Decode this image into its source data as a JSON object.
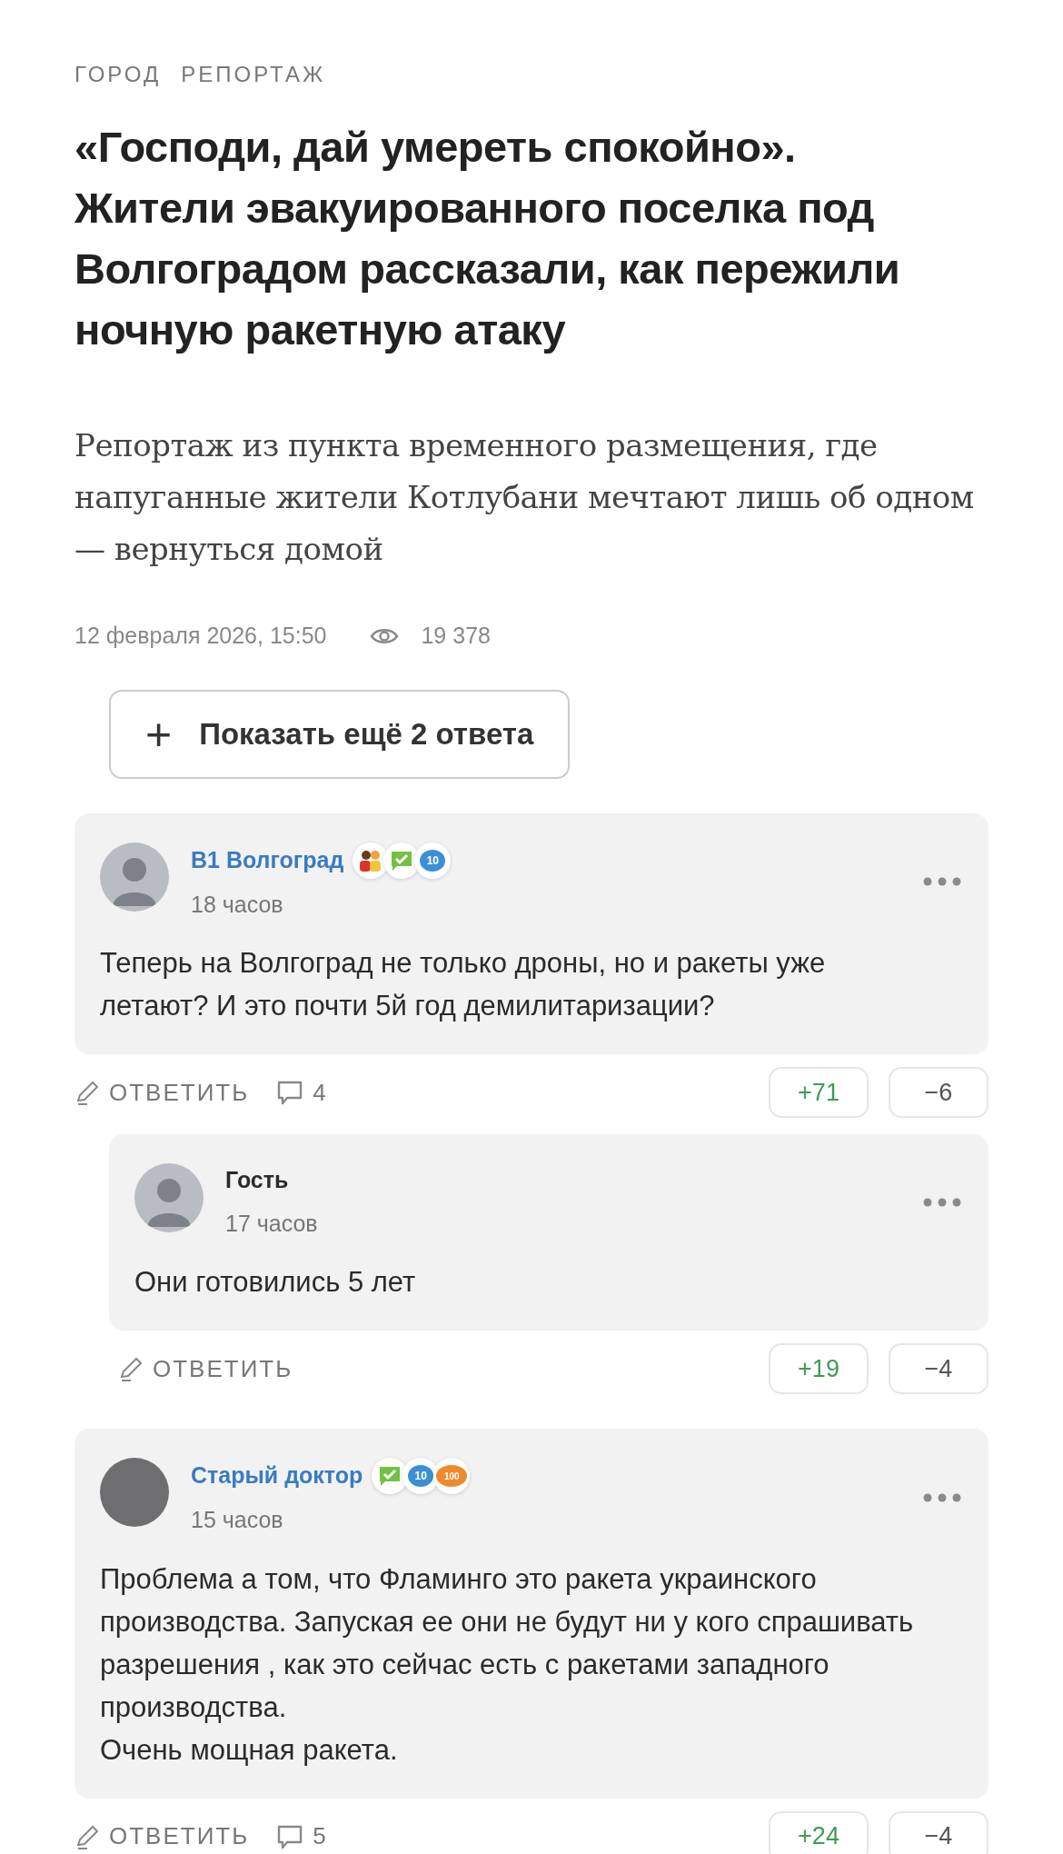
{
  "rubrics": [
    "ГОРОД",
    "РЕПОРТАЖ"
  ],
  "title": "«Господи, дай умереть спокойно». Жители эвакуированного поселка под Волгоградом рассказали, как пережили ночную ракетную атаку",
  "lead": "Репортаж из пункта временного размещения, где напуганные жители Котлубани мечтают лишь об одном — вернуться домой",
  "meta": {
    "date": "12 февраля 2026, 15:50",
    "views": "19 378"
  },
  "show_more": {
    "icon": "+",
    "label": "Показать ещё 2 ответа"
  },
  "comments": [
    {
      "author": "В1 Волгоград",
      "registered": true,
      "avatar": {
        "kind": "silhouette"
      },
      "badges": [
        {
          "kind": "people"
        },
        {
          "kind": "check"
        },
        {
          "kind": "bubble",
          "color": "#3c8fd6",
          "label": "10"
        }
      ],
      "time": "18 часов",
      "text": "Теперь на Волгоград не только дроны, но и ракеты уже летают? И это почти 5й год демилитаризации?",
      "reply": "ОТВЕТИТЬ",
      "replies_count": "4",
      "up": "+71",
      "down": "−6",
      "children": [
        {
          "author": "Гость",
          "registered": false,
          "avatar": {
            "kind": "silhouette"
          },
          "time": "17 часов",
          "text": "Они готовились 5 лет",
          "reply": "ОТВЕТИТЬ",
          "up": "+19",
          "down": "−4"
        }
      ]
    },
    {
      "author": "Старый доктор",
      "registered": true,
      "avatar": {
        "kind": "photo"
      },
      "badges": [
        {
          "kind": "check"
        },
        {
          "kind": "bubble",
          "color": "#3c8fd6",
          "label": "10"
        },
        {
          "kind": "bubble",
          "color": "#ef8a2c",
          "label": "100"
        }
      ],
      "time": "15 часов",
      "text": "Проблема а том, что Фламинго это ракета украинского производства. Запуская ее они не будут ни у кого спрашивать разрешения , как это сейчас есть с ракетами западного производства.\nОчень мощная ракета.",
      "reply": "ОТВЕТИТЬ",
      "replies_count": "5",
      "up": "+24",
      "down": "−4"
    }
  ]
}
